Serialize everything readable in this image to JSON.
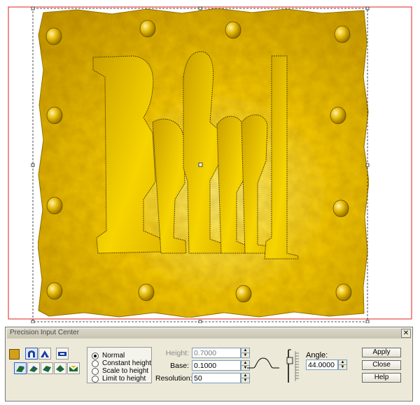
{
  "panel": {
    "title": "Precision Input Center",
    "close_label": "✕",
    "color_swatch": "#d4a017",
    "tool_icons": [
      "dome-profile-icon",
      "arch-profile-icon",
      "panel-profile-icon",
      "sweep-icon-1",
      "sweep-icon-2",
      "sweep-icon-3",
      "sweep-icon-4",
      "sweep-icon-5"
    ],
    "modes": [
      {
        "label": "Normal",
        "selected": true
      },
      {
        "label": "Constant height",
        "selected": false
      },
      {
        "label": "Scale to height",
        "selected": false
      },
      {
        "label": "Limit to height",
        "selected": false
      }
    ],
    "fields": {
      "height": {
        "label": "Height:",
        "value": "0.7000"
      },
      "base": {
        "label": "Base:",
        "value": "0.1000"
      },
      "resolution": {
        "label": "Resolution:",
        "value": "50"
      },
      "angle": {
        "label": "Angle:",
        "value": "44.0000"
      }
    },
    "buttons": {
      "apply": "Apply",
      "close": "Close",
      "help": "Help"
    }
  },
  "canvas": {
    "relief_text": "Rafael",
    "colors": {
      "gold": "#f2c400",
      "gold_dark": "#b88f00",
      "selection_border": "#e02020"
    }
  }
}
